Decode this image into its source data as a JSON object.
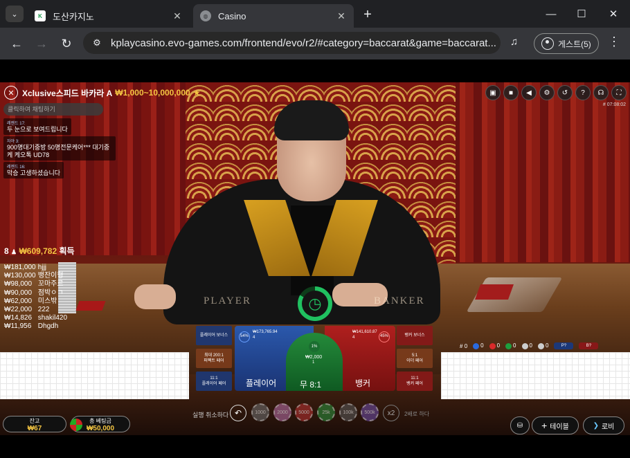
{
  "browser": {
    "tabs": [
      {
        "title": "도산카지노",
        "favicon": "kplay-logo-icon"
      },
      {
        "title": "Casino",
        "favicon": "globe-icon"
      }
    ],
    "url": "kplaycasino.evo-games.com/frontend/evo/r2/#category=baccarat&game=baccarat...",
    "profile_label": "게스트(5)",
    "new_tab_label": "+"
  },
  "game": {
    "title": "Xclusive스피드 바카라 A",
    "limits": "₩1,000~10,000,000",
    "table_id": "# 07:08:02",
    "felt_player": "PLAYER",
    "felt_banker": "BANKER"
  },
  "chat": {
    "placeholder": "클릭하여 채팅하기",
    "messages": [
      {
        "user": "레젠드 17:",
        "text": "두 눈으로 보여드립니다"
      },
      {
        "user": "자야 3:",
        "text": "900명대기중방 50명전문케어*** 대기중 케 케오톡 UD78"
      },
      {
        "user": "레젠드 16:",
        "text": "막승 고생하셨습니다"
      }
    ]
  },
  "winners_summary": {
    "count": "8",
    "amount": "₩609,782",
    "suffix": "획득"
  },
  "winners": [
    {
      "amount": "₩181,000",
      "name": "hjjj"
    },
    {
      "amount": "₩130,000",
      "name": "뱅잔이형"
    },
    {
      "amount": "₩98,000",
      "name": "꼬마주르"
    },
    {
      "amount": "₩90,000",
      "name": "점박ㅇㄱ"
    },
    {
      "amount": "₩62,000",
      "name": "미스밖"
    },
    {
      "amount": "₩22,000",
      "name": "222"
    },
    {
      "amount": "₩14,826",
      "name": "shakil420"
    },
    {
      "amount": "₩11,956",
      "name": "Dhgdh"
    }
  ],
  "bets": {
    "player_dragon": "플레이어 보너스",
    "player_pair_top": "퍼펙트 페어",
    "player_pair_ratio": "11:1",
    "player_pair": "플레이어 페어",
    "banker_dragon": "뱅커 보너스",
    "either_ratio": "5:1",
    "either_pair": "이더 페어",
    "banker_pair_ratio": "11:1",
    "banker_pair": "뱅커 페어",
    "player_main": "플레이어",
    "tie_main": "무 8:1",
    "banker_main": "뱅커",
    "player_pct": "54%",
    "player_total": "₩173,765.94",
    "player_count": "4",
    "tie_pct": "1%",
    "tie_total": "₩2,000",
    "tie_count": "1",
    "banker_pct": "45%",
    "banker_total": "₩141,610.87",
    "banker_count": "4",
    "placed_chip": "50k",
    "pair_top_hint": "최대 200:1"
  },
  "road_counts": [
    {
      "label": "#",
      "value": "0",
      "color": "#ffffff"
    },
    {
      "label": "P",
      "value": "0",
      "color": "#2a6adf"
    },
    {
      "label": "B",
      "value": "0",
      "color": "#d92a2a"
    },
    {
      "label": "T",
      "value": "0",
      "color": "#1e9e3e"
    },
    {
      "label": "",
      "value": "0",
      "color": "#cccccc"
    },
    {
      "label": "",
      "value": "0",
      "color": "#cccccc"
    }
  ],
  "predictions": {
    "player": "P?",
    "banker": "B?"
  },
  "controls": {
    "undo_label": "실행 취소하다",
    "chips": [
      "1000",
      "2000",
      "5000",
      "25k",
      "100k",
      "500k"
    ],
    "double_label": "x2",
    "double_text": "2배로 하다",
    "balance_label": "잔고",
    "balance_value": "₩67",
    "total_bet_label": "총 베팅금",
    "total_bet_value": "₩50,000",
    "table_btn": "테이블",
    "lobby_btn": "로비"
  },
  "colors": {
    "gold": "#f4c542",
    "player_blue": "#1c3878",
    "banker_red": "#881818",
    "tie_green": "#248a3a",
    "timer_green": "#20c060"
  }
}
